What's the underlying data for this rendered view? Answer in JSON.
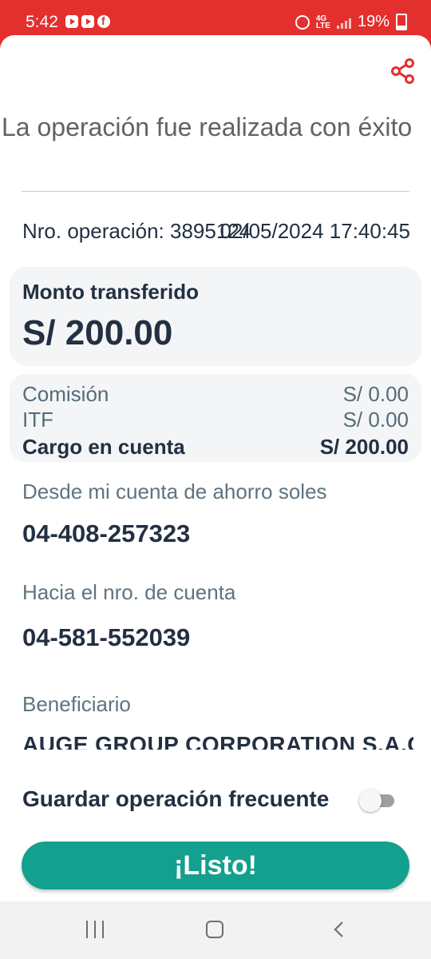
{
  "status_bar": {
    "time": "5:42",
    "net_top": "4G",
    "net_bottom": "LTE",
    "battery": "19%"
  },
  "sheet": {
    "title": "La operación fue realizada con éxito",
    "operation": {
      "label": "Nro. operación: 3895124",
      "datetime": "02/05/2024 17:40:45"
    },
    "amount": {
      "label": "Monto transferido",
      "value": "S/ 200.00"
    },
    "fees": [
      {
        "label": "Comisión",
        "value": "S/ 0.00"
      },
      {
        "label": "ITF",
        "value": "S/ 0.00"
      },
      {
        "label": "Cargo en cuenta",
        "value": "S/ 200.00"
      }
    ],
    "from": {
      "label": "Desde mi cuenta de ahorro soles",
      "value": "04-408-257323"
    },
    "to": {
      "label": "Hacia el nro. de cuenta",
      "value": "04-581-552039"
    },
    "beneficiary": {
      "label": "Beneficiario",
      "value": "AUGE GROUP CORPORATION S.A.C."
    },
    "save_frequent": {
      "label": "Guardar operación frecuente",
      "enabled": false
    },
    "done_button": "¡Listo!"
  },
  "colors": {
    "brand_red": "#e42f2f",
    "accent_teal": "#13a08e",
    "text_dark": "#233042"
  }
}
